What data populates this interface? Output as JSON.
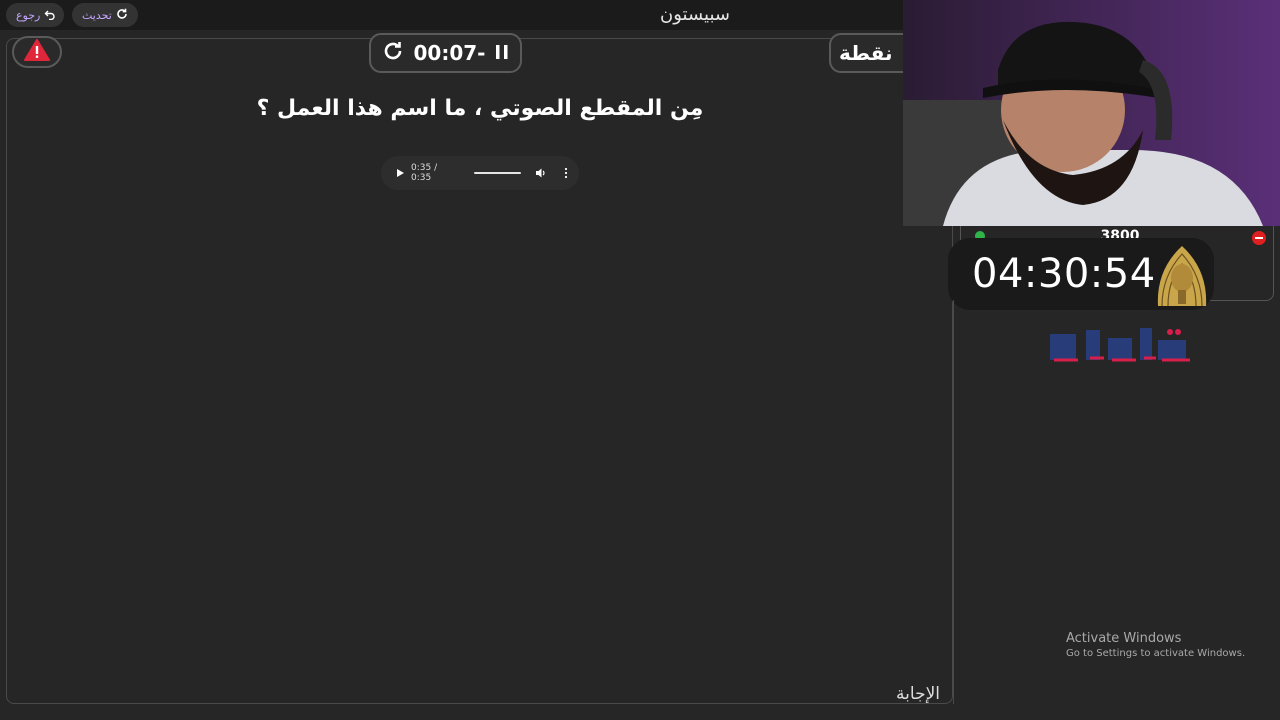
{
  "header": {
    "back_label": "رجوع",
    "refresh_label": "تحديث",
    "game_title": "سبيستون"
  },
  "board": {
    "timer": "00:07-",
    "score_label": "نقطة",
    "question": "مِن المقطع الصوتي ، ما اسم هذا العمل ؟",
    "audio": {
      "time": "0:35 / 0:35",
      "progress": 1.0
    },
    "answer_label": "الإجابة"
  },
  "stream_overlay": {
    "goal_number": "3800",
    "countdown": "04:30:54"
  },
  "windows": {
    "activate_title": "Activate Windows",
    "activate_sub": "Go to Settings to activate Windows."
  },
  "colors": {
    "background": "#262626",
    "topbar": "#1b1b1b",
    "accent_purple": "#c7a6ff",
    "alert_red": "#e0263a",
    "logo_blue": "#283c7a",
    "logo_red": "#d81e4a"
  }
}
